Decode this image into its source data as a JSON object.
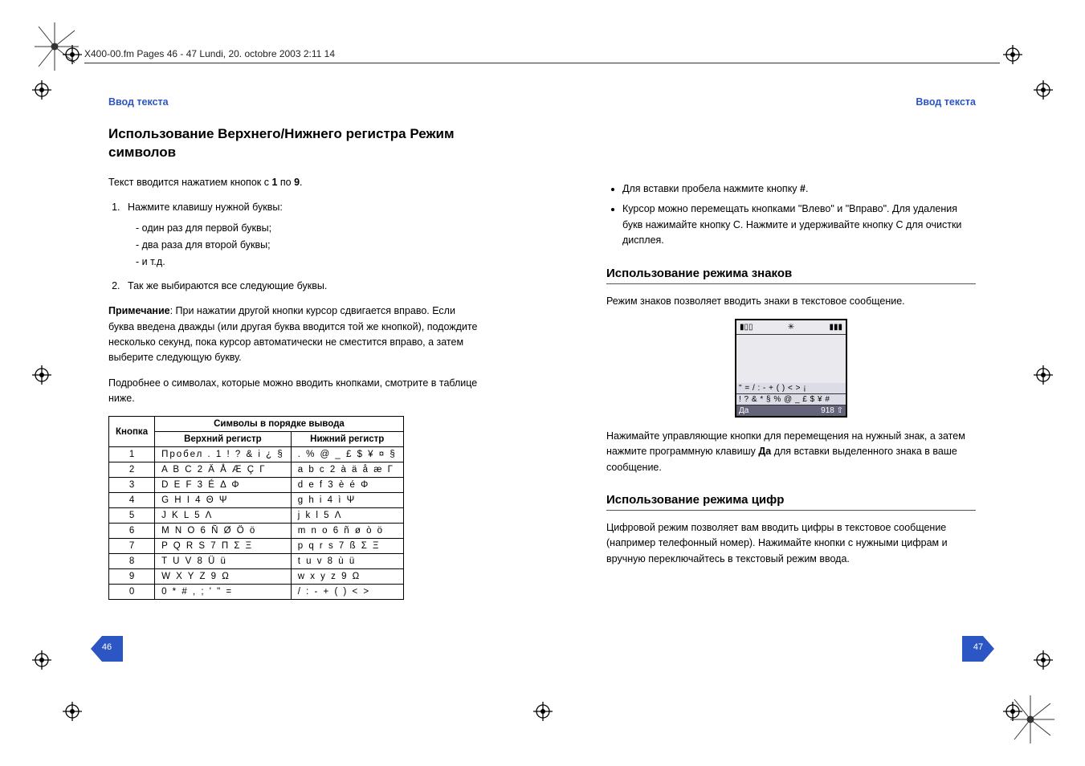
{
  "fm_header": "X400-00.fm  Pages 46 - 47  Lundi, 20. octobre 2003  2:11 14",
  "left": {
    "running": "Ввод текста",
    "title": "Использование Верхнего/Нижнего регистра Режим символов",
    "intro_a": "Текст вводится нажатием кнопок с ",
    "intro_b": " по ",
    "intro_1": "1",
    "intro_9": "9",
    "intro_end": ".",
    "step1": "Нажмите клавишу нужной буквы:",
    "step1a": "- один раз для первой буквы;",
    "step1b": "- два раза для второй буквы;",
    "step1c": "- и т.д.",
    "step2": "Так же выбираются все следующие буквы.",
    "note_label": "Примечание",
    "note_body": ": При нажатии другой кнопки курсор сдвигается вправо. Если буква введена дважды (или другая буква вводится той же кнопкой), подождите несколько секунд, пока курсор автоматически не сместится вправо, а затем выберите следующую букву.",
    "table_intro": "Подробнее о символах, которые можно вводить кнопками, смотрите в таблице ниже.",
    "th_key": "Кнопка",
    "th_symbols": "Символы в порядке вывода",
    "th_upper": "Верхний регистр",
    "th_lower": "Нижний регистр",
    "rows": [
      {
        "k": "1",
        "u": "Пробел . 1 ! ? & i ¿ §",
        "l": ". % @ _ £ $ ¥ ¤ §"
      },
      {
        "k": "2",
        "u": "A B C 2 Ä Å Æ Ç Γ",
        "l": "a b c 2 à ä å æ Γ"
      },
      {
        "k": "3",
        "u": "D E F 3 É Δ Φ",
        "l": "d e f 3 è é Φ"
      },
      {
        "k": "4",
        "u": "G H I 4 Θ Ψ",
        "l": "g h i 4 ì Ψ"
      },
      {
        "k": "5",
        "u": "J K L 5 Λ",
        "l": "j k l 5 Λ"
      },
      {
        "k": "6",
        "u": "M N O 6 Ñ Ø Ö ö",
        "l": "m n o 6 ñ ø ò ö"
      },
      {
        "k": "7",
        "u": "P Q R S 7 Π Σ Ξ",
        "l": "p q r s 7 ß Σ Ξ"
      },
      {
        "k": "8",
        "u": "T U V 8 Ü ü",
        "l": "t u v 8 ù ü"
      },
      {
        "k": "9",
        "u": "W X Y Z 9 Ω",
        "l": "w x y z 9 Ω"
      },
      {
        "k": "0",
        "u": "0 * # , ; ' \" =",
        "l": "/ : - + ( ) < >"
      }
    ],
    "pagenum": "46"
  },
  "right": {
    "running": "Ввод текста",
    "bullet1_a": "Для вставки пробела нажмите кнопку ",
    "bullet1_b": ".",
    "bullet2": "Курсор можно перемещать кнопками \"Влево\" и \"Вправо\". Для удаления букв нажимайте кнопку C. Нажмите и удерживайте кнопку C для очистки дисплея.",
    "sec2": "Использование режима знаков",
    "sec2_p1": "Режим знаков позволяет вводить знаки в текстовое сообщение.",
    "screen_sym1": "\" = / : - + ( ) < > ¡",
    "screen_sym2": "! ? & * § % @ _ £ $ ¥ #",
    "screen_soft_left": "Да",
    "screen_soft_right": "918 ⇧",
    "sec2_p2_a": "Нажимайте управляющие кнопки для перемещения на нужный знак, а затем нажмите программную клавишу ",
    "sec2_p2_bold": "Да",
    "sec2_p2_b": " для вставки выделенного знака в ваше сообщение.",
    "sec3": "Использование режима цифр",
    "sec3_p": "Цифровой режим позволяет вам вводить цифры в текстовое сообщение (например телефонный номер). Нажимайте кнопки с нужными цифрам и вручную переключайтесь в текстовый режим ввода.",
    "pagenum": "47"
  }
}
